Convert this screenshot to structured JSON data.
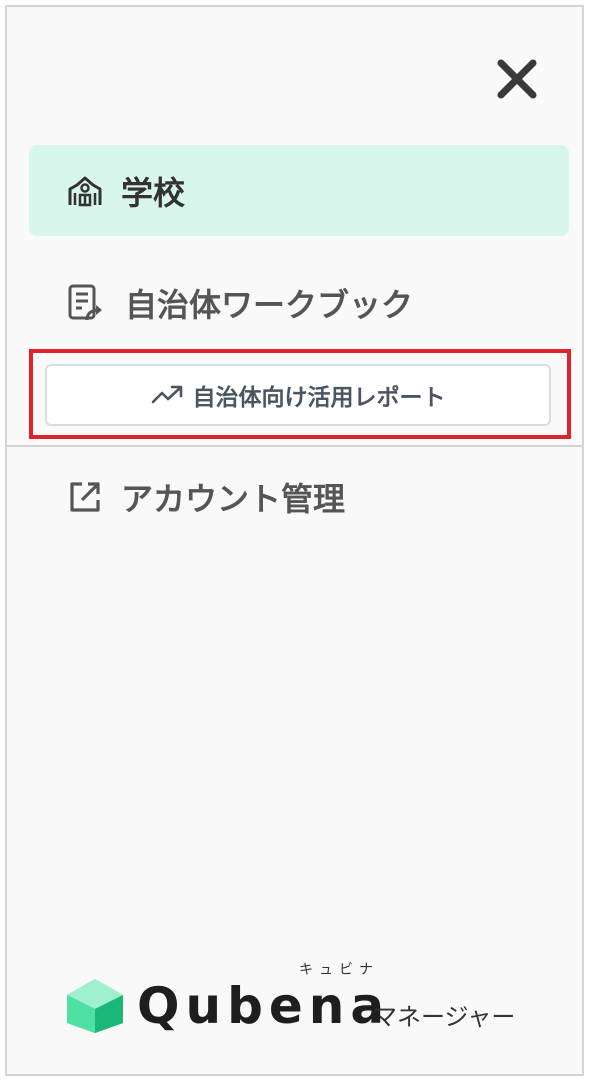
{
  "menu": {
    "close_icon": "close-icon",
    "items": [
      {
        "label": "学校",
        "icon": "school-icon",
        "active": true
      },
      {
        "label": "自治体ワークブック",
        "icon": "workbook-icon",
        "active": false
      },
      {
        "label": "自治体向け活用レポート",
        "icon": "trending-up-icon",
        "highlighted": true
      },
      {
        "label": "アカウント管理",
        "icon": "external-link-icon",
        "active": false
      }
    ]
  },
  "brand": {
    "name": "Qubena",
    "ruby": "キュビナ",
    "suffix": "マネージャー"
  },
  "colors": {
    "active_bg": "#d8f6ec",
    "highlight_border": "#e0232a",
    "logo_green": "#2fcf8a",
    "text_primary": "#333333",
    "text_secondary": "#555555"
  }
}
